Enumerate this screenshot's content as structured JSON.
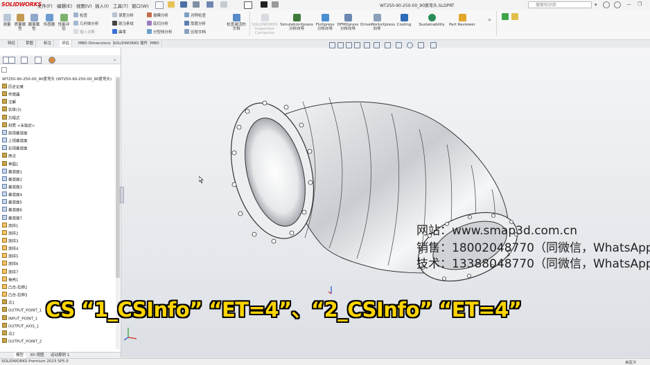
{
  "app": {
    "logo": "SOLIDWORKS",
    "document_title": "WT250-90-250-00_90度弯头.SLDPRT",
    "search_placeholder": "搜索知识库"
  },
  "menu": [
    "文件(F)",
    "编辑(E)",
    "视图(V)",
    "插入(I)",
    "工具(T)",
    "窗口(W)"
  ],
  "ribbon": {
    "big_buttons": [
      {
        "label": "测量",
        "icon": "measure-icon"
      },
      {
        "label": "质量属性",
        "icon": "mass-properties-icon"
      },
      {
        "label": "截面属性",
        "icon": "section-properties-icon"
      },
      {
        "label": "传感器",
        "icon": "sensor-icon"
      },
      {
        "label": "性能评估",
        "icon": "performance-icon"
      }
    ],
    "col1": [
      "检查",
      "几何体分析",
      "输入诊断"
    ],
    "col2": [
      "误差分析",
      "斑马条纹",
      "曲率"
    ],
    "col3": [
      "拔模分析",
      "底切分析",
      "分型线分析"
    ],
    "col4": [
      "对称检查",
      "厚度分析",
      "比较文档"
    ],
    "check_active_doc": "检查激活的文档",
    "addin_buttons": [
      "SOLIDWORKS Inspection Connector",
      "SimulationXpress 分析向导",
      "FloXpress 分析向导",
      "DFMXpress 分析向导",
      "DriveWorksXpress 向导",
      "Costing",
      "Sustainability",
      "Part Reviewer"
    ]
  },
  "command_tabs": [
    "特征",
    "草图",
    "标注",
    "评估",
    "MBD Dimensions",
    "SOLIDWORKS 插件",
    "MBD"
  ],
  "active_command_tab": "评估",
  "feature_tree": {
    "root": "WT250-90-250-00_90度弯头 (WT250-90-250-00_90度弯头)",
    "items": [
      "历史记录",
      "传感器",
      "注解",
      "实体(3)",
      "方程式",
      "材质 <未指定>",
      "前视基准面",
      "上视基准面",
      "右视基准面",
      "原点",
      "草图1",
      "基准面1",
      "基准面2",
      "基准面3",
      "基准面4",
      "基准面5",
      "基准面6",
      "基准面7",
      "放样1",
      "放样2",
      "放样3",
      "放样4",
      "放样5",
      "放样6",
      "放样7",
      "抽壳1",
      "凸台-拉伸2",
      "凸台-拉伸3",
      "点1",
      "OUTPUT_POINT_1",
      "INPUT_POINT_1",
      "OUTPUT_AXIS_1",
      "点2",
      "OUTPUT_POINT_2"
    ]
  },
  "bottom_tabs": [
    "模型",
    "3D 视图",
    "运动算例 1"
  ],
  "status": {
    "left": "SOLIDWORKS Premium 2023 SP5.0",
    "right": "自定义"
  },
  "watermark": {
    "site": "网站：www.smap3d.com.cn",
    "sales": "销售：18002048770（同微信，WhatsApp",
    "tech": "技术：13388048770（同微信，WhatsApp"
  },
  "subtitle": "CS “1_CSInfo” “ET=4”、“2_CSInfo” “ET=4”",
  "colors": {
    "accent": "#d5161b",
    "subtitle_fill": "#ffd400",
    "viewport_bg": "#eceef1"
  }
}
